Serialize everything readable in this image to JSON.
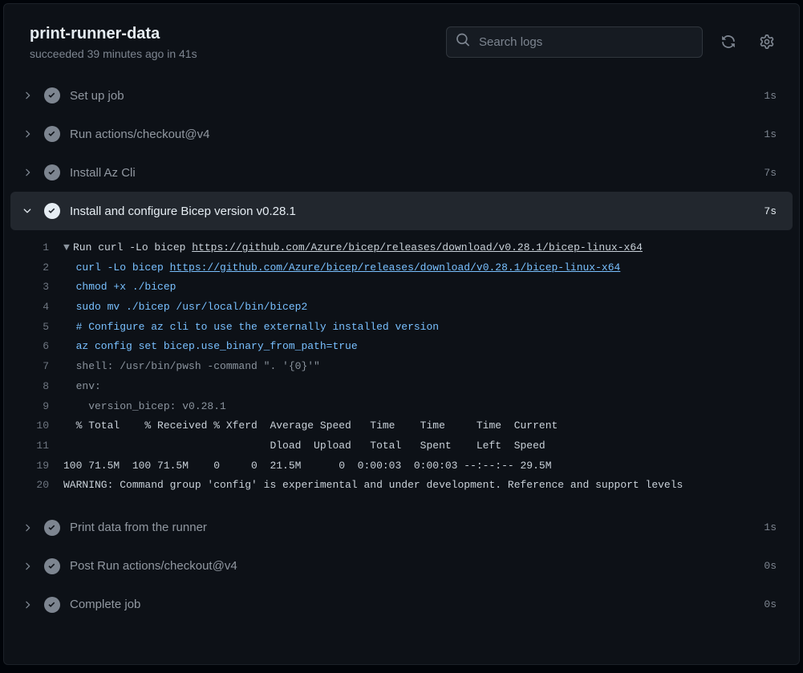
{
  "header": {
    "title": "print-runner-data",
    "subtitle": "succeeded 39 minutes ago in 41s",
    "search_placeholder": "Search logs"
  },
  "steps": [
    {
      "label": "Set up job",
      "time": "1s",
      "expanded": false
    },
    {
      "label": "Run actions/checkout@v4",
      "time": "1s",
      "expanded": false
    },
    {
      "label": "Install Az Cli",
      "time": "7s",
      "expanded": false
    },
    {
      "label": "Install and configure Bicep version v0.28.1",
      "time": "7s",
      "expanded": true
    },
    {
      "label": "Print data from the runner",
      "time": "1s",
      "expanded": false
    },
    {
      "label": "Post Run actions/checkout@v4",
      "time": "0s",
      "expanded": false
    },
    {
      "label": "Complete job",
      "time": "0s",
      "expanded": false
    }
  ],
  "log": {
    "url": "https://github.com/Azure/bicep/releases/download/v0.28.1/bicep-linux-x64",
    "lines": {
      "l1_prefix": "Run curl -Lo bicep ",
      "l2": "  curl -Lo bicep ",
      "l3": "  chmod +x ./bicep",
      "l4": "  sudo mv ./bicep /usr/local/bin/bicep2",
      "l5": "  # Configure az cli to use the externally installed version",
      "l6": "  az config set bicep.use_binary_from_path=true",
      "l7": "  shell: /usr/bin/pwsh -command \". '{0}'\"",
      "l8": "  env:",
      "l9": "    version_bicep: v0.28.1",
      "l10": "  % Total    % Received % Xferd  Average Speed   Time    Time     Time  Current",
      "l11": "                                 Dload  Upload   Total   Spent    Left  Speed",
      "l19": "100 71.5M  100 71.5M    0     0  21.5M      0  0:00:03  0:00:03 --:--:-- 29.5M",
      "l20": "WARNING: Command group 'config' is experimental and under development. Reference and support levels"
    },
    "line_numbers": [
      "1",
      "2",
      "3",
      "4",
      "5",
      "6",
      "7",
      "8",
      "9",
      "10",
      "11",
      "19",
      "20"
    ]
  }
}
